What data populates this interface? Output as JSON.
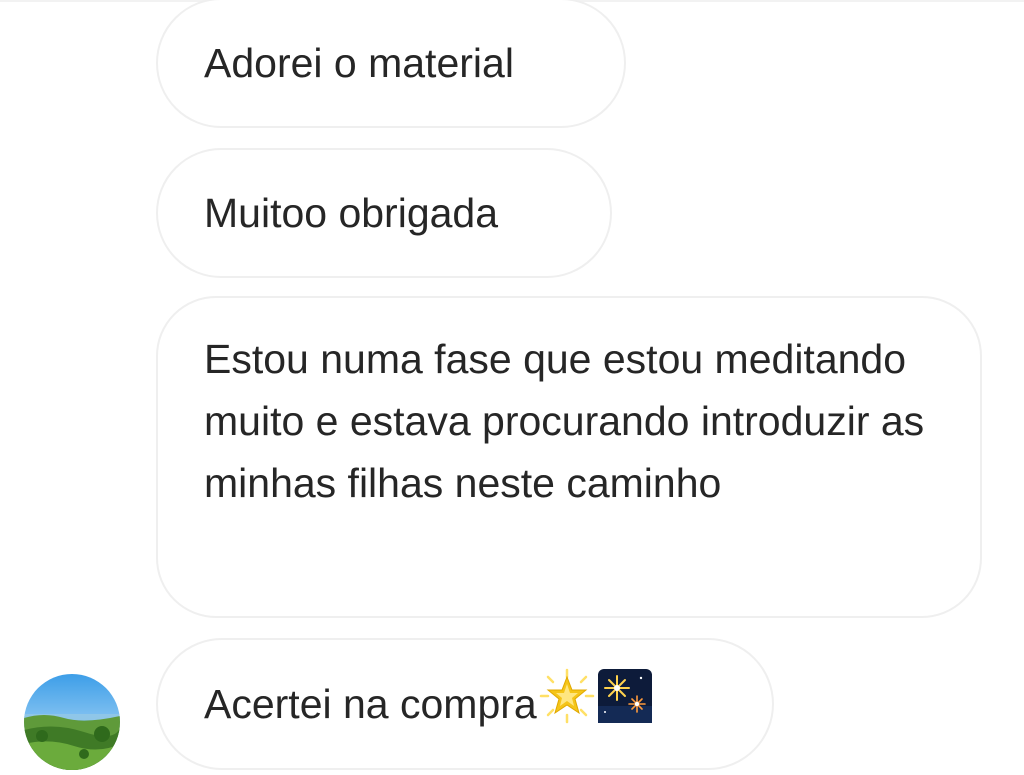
{
  "conversation": {
    "messages": [
      {
        "text": "Adorei o material"
      },
      {
        "text": "Muitoo obrigada"
      },
      {
        "text": "Estou numa fase que estou meditando muito e estava procurando introduzir as minhas filhas neste caminho"
      },
      {
        "text": "Acertei na compra",
        "emojis": [
          "glowing-star-emoji",
          "fireworks-emoji"
        ]
      }
    ],
    "sender_avatar": {
      "icon": "landscape-avatar"
    }
  },
  "colors": {
    "background": "#ffffff",
    "bubble_border": "#efefef",
    "text": "#262626",
    "star": "#f5c518",
    "night_sky": "#0d1b3a"
  }
}
